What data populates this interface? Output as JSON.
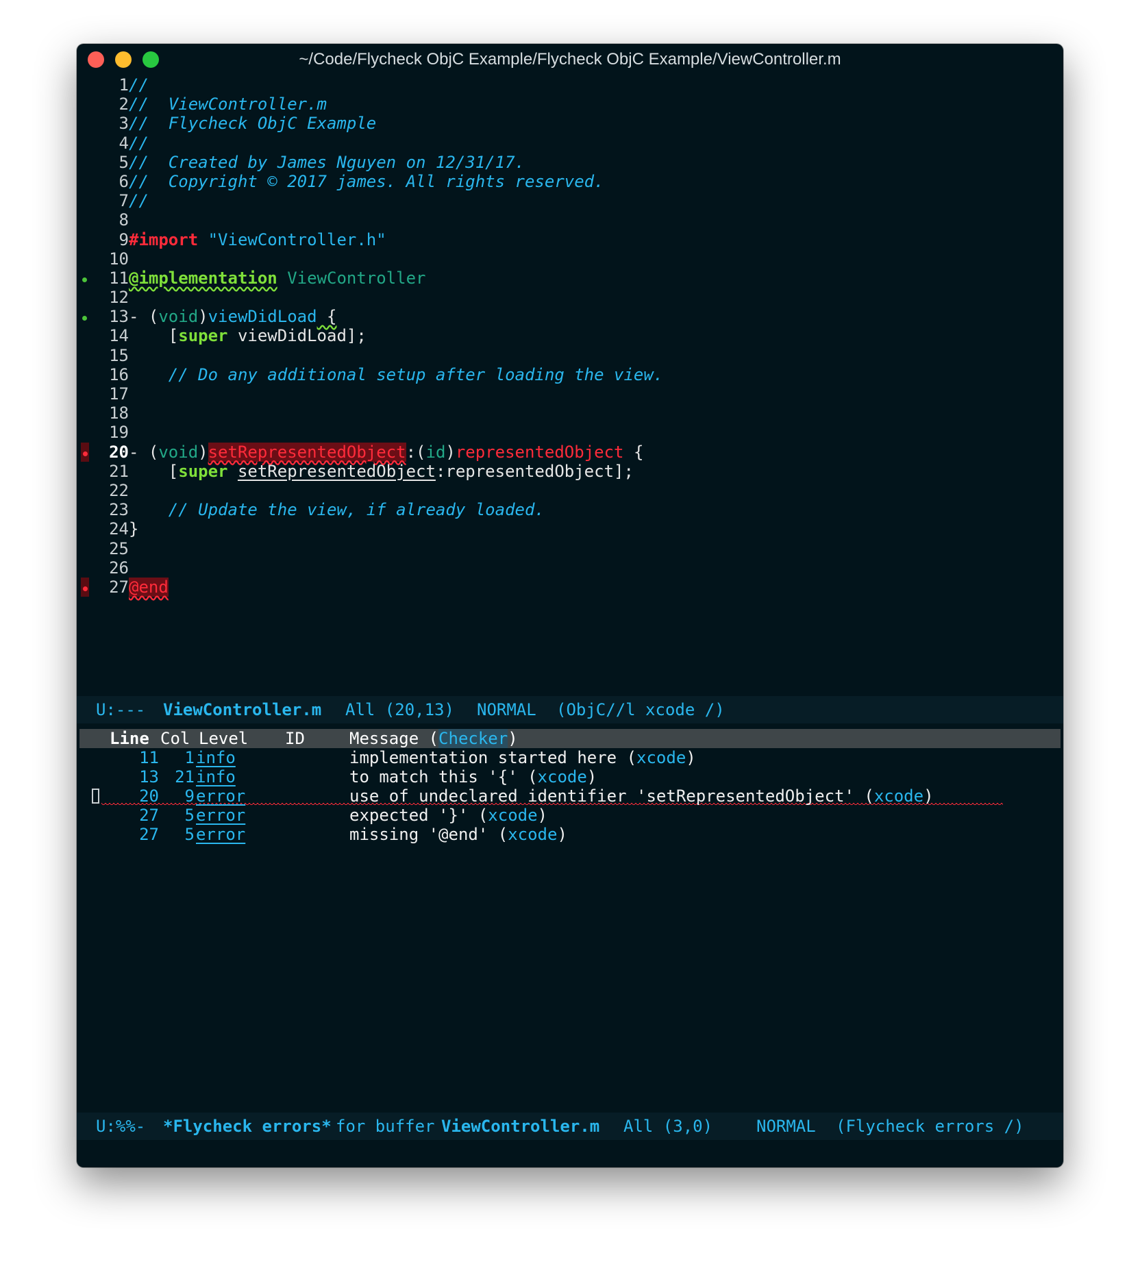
{
  "window": {
    "title": "~/Code/Flycheck ObjC Example/Flycheck ObjC Example/ViewController.m"
  },
  "editor": {
    "lines": [
      {
        "n": "1",
        "text": "//"
      },
      {
        "n": "2",
        "text": "//  ViewController.m"
      },
      {
        "n": "3",
        "text": "//  Flycheck ObjC Example"
      },
      {
        "n": "4",
        "text": "//"
      },
      {
        "n": "5",
        "text": "//  Created by James Nguyen on 12/31/17."
      },
      {
        "n": "6",
        "text": "//  Copyright © 2017 james. All rights reserved."
      },
      {
        "n": "7",
        "text": "//"
      },
      {
        "n": "8",
        "text": ""
      },
      {
        "n": "9",
        "import_kw": "#import",
        "import_file": "\"ViewController.h\""
      },
      {
        "n": "10",
        "text": ""
      },
      {
        "n": "11",
        "impl_kw": "@implementation",
        "impl_name": "ViewController"
      },
      {
        "n": "12",
        "text": ""
      },
      {
        "n": "13",
        "dash": "- (",
        "type": "void",
        "close": ")",
        "method": "viewDidLoad",
        "brace": " {"
      },
      {
        "n": "14",
        "open": "    [",
        "super_kw": "super",
        "call": " viewDidLoad];"
      },
      {
        "n": "15",
        "text": ""
      },
      {
        "n": "16",
        "text": "    // Do any additional setup after loading the view."
      },
      {
        "n": "17",
        "text": ""
      },
      {
        "n": "18",
        "text": ""
      },
      {
        "n": "19",
        "text": ""
      },
      {
        "n": "20",
        "dash": "- (",
        "type": "void",
        "close": ")",
        "method": "setRepresentedObject",
        "colon": ":(",
        "type2": "id",
        "close2": ")",
        "param": "representedObject",
        "brace": " {"
      },
      {
        "n": "21",
        "open": "    [",
        "super_kw": "super",
        "sp": " ",
        "call": "setRepresentedObject",
        "rest": ":representedObject];"
      },
      {
        "n": "22",
        "text": ""
      },
      {
        "n": "23",
        "text": "    // Update the view, if already loaded."
      },
      {
        "n": "24",
        "text": "}"
      },
      {
        "n": "25",
        "text": ""
      },
      {
        "n": "26",
        "text": ""
      },
      {
        "n": "27",
        "end_kw": "@end"
      }
    ]
  },
  "modeline_top": {
    "state": "U:---",
    "buffer": "ViewController.m",
    "position": "All (20,13)",
    "mode": "NORMAL",
    "major": "(ObjC//l xcode /)"
  },
  "errors": {
    "headers": {
      "line": "Line",
      "col": "Col",
      "level": "Level",
      "id": "ID",
      "message": "Message (",
      "checker": "Checker",
      "close": ")"
    },
    "rows": [
      {
        "line": "11",
        "col": "1",
        "level": "info",
        "message": "implementation started here (",
        "checker": "xcode",
        "close": ")"
      },
      {
        "line": "13",
        "col": "21",
        "level": "info",
        "message": "to match this '{' (",
        "checker": "xcode",
        "close": ")"
      },
      {
        "line": "20",
        "col": "9",
        "level": "error",
        "message": "use of undeclared identifier 'setRepresentedObject' (",
        "checker": "xcode",
        "close": ")"
      },
      {
        "line": "27",
        "col": "5",
        "level": "error",
        "message": "expected '}' (",
        "checker": "xcode",
        "close": ")"
      },
      {
        "line": "27",
        "col": "5",
        "level": "error",
        "message": "missing '@end' (",
        "checker": "xcode",
        "close": ")"
      }
    ]
  },
  "modeline_bottom": {
    "state": "U:%%-",
    "buffer": "*Flycheck errors*",
    "for_text": "for buffer",
    "target": "ViewController.m",
    "position": "All (3,0)",
    "mode": "NORMAL",
    "major": "(Flycheck errors /)"
  },
  "colors": {
    "background": "#02141b",
    "comment": "#2ab7ee",
    "error": "#ff2b3a",
    "keyword": "#7fe03a",
    "type": "#22a887"
  }
}
